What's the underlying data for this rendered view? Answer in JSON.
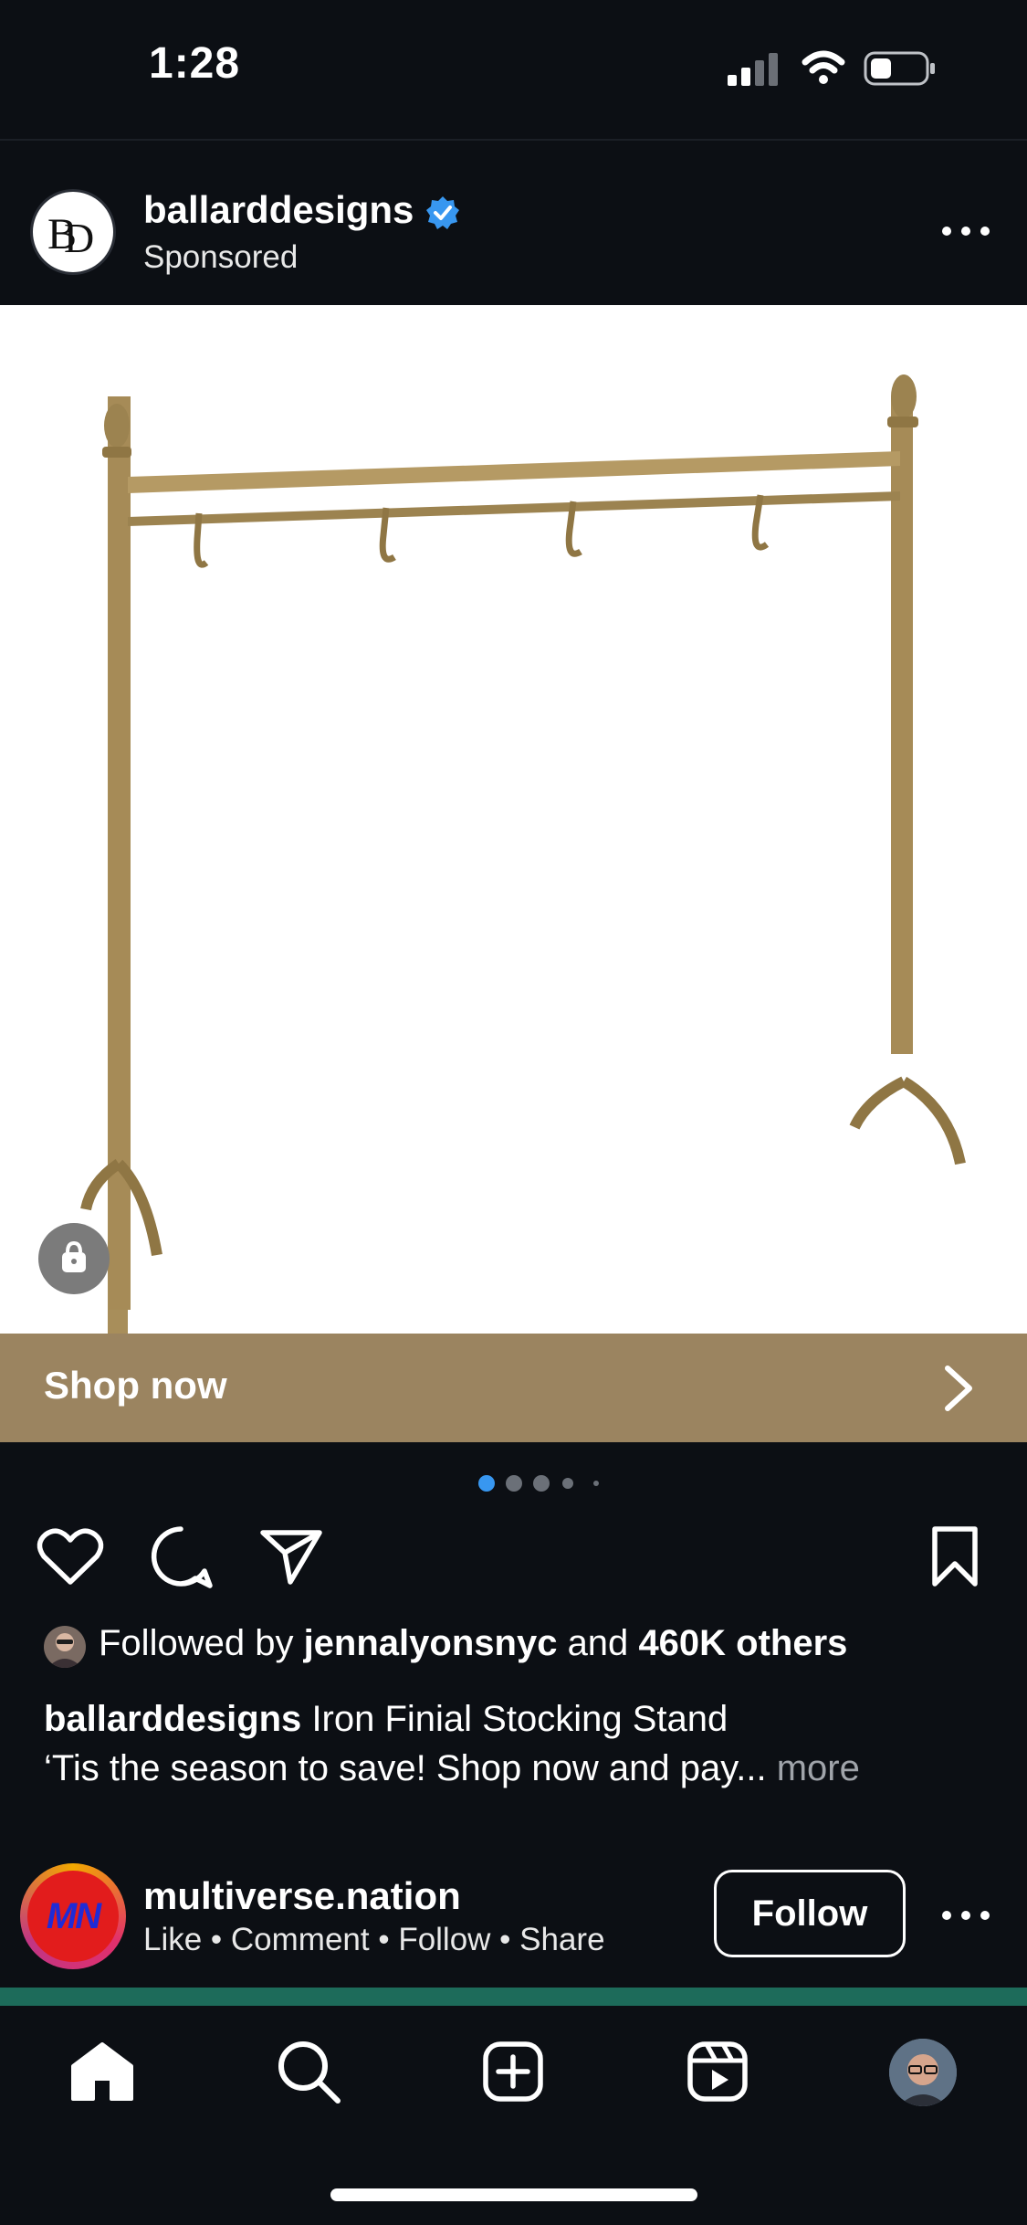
{
  "status_bar": {
    "time": "1:28",
    "icons": [
      "signal-icon",
      "wifi-icon",
      "battery-icon"
    ]
  },
  "post": {
    "account": {
      "name": "ballarddesigns",
      "verified": true,
      "subtitle": "Sponsored",
      "avatar_monogram": "BD"
    },
    "image_alt_icon": "shopping-bag-icon",
    "cta": {
      "label": "Shop now",
      "color": "#9b8460"
    },
    "carousel": {
      "total_dots": 5,
      "active_index": 0,
      "active_color": "#3897f0"
    },
    "actions": [
      "heart-icon",
      "comment-icon",
      "share-icon",
      "bookmark-icon"
    ],
    "followed_by": {
      "prefix": "Followed by",
      "user": "jennalyonsnyc",
      "connector": "and",
      "others": "460K others"
    },
    "caption": {
      "username": "ballarddesigns",
      "title": "Iron Finial Stocking Stand",
      "text": "‘Tis the season to save! Shop now and pay...",
      "more": "more"
    }
  },
  "next_post": {
    "account": {
      "name": "multiverse.nation",
      "avatar_text": "MN",
      "subtitle": "Like • Comment • Follow • Share"
    },
    "follow_label": "Follow"
  },
  "tab_bar": {
    "tabs": [
      "home-icon",
      "search-icon",
      "create-icon",
      "reels-icon",
      "profile-avatar"
    ],
    "active": "home-icon"
  },
  "colors": {
    "background": "#0c0f14",
    "verified_badge": "#3897f0",
    "muted_text": "#a0a4aa"
  }
}
